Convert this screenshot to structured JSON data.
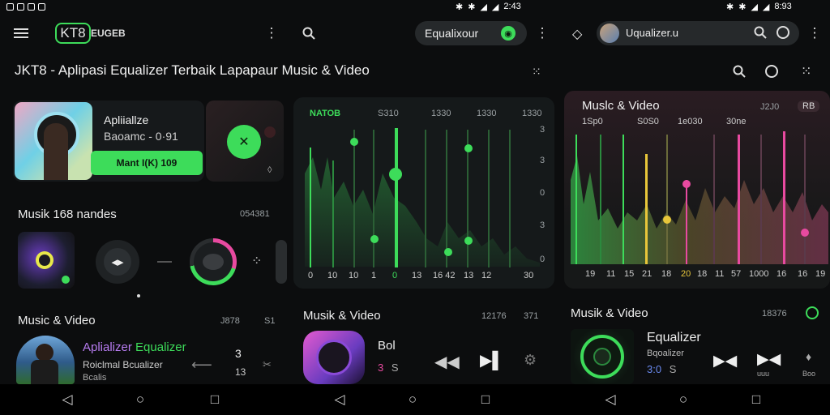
{
  "status_bar": {
    "left_time": "2:43",
    "right_time": "8:93"
  },
  "left_screen": {
    "logo_text": "KT8",
    "logo_suffix": "EUGEB",
    "headline": "JKT8 - Aplipasi Equalizer Terbaik Lapapaur Music & Video",
    "feature_card": {
      "title": "Apliiallze",
      "subtitle": "Baoamc - 0·91",
      "button_label": "Mant I(K) 109"
    },
    "section_title": "Musik 168 nandes",
    "section_meta": "054381",
    "music_section": {
      "title": "Music & Video",
      "meta1": "J878",
      "meta2": "S1"
    },
    "track": {
      "title_part1": "Aplializer",
      "title_part2": "Equalizer",
      "subtitle": "Roiclmal Bcualizer",
      "caption": "Bcalis",
      "number_top": "3",
      "number_bottom": "13"
    }
  },
  "middle_screen": {
    "search_pill_text": "Equalixour",
    "eq_header": {
      "label1": "NATOB",
      "label2": "S310",
      "label3": "1330",
      "label4": "1330",
      "label5": "1330"
    },
    "right_ticks": [
      "3",
      "3",
      "0",
      "3",
      "0"
    ],
    "bottom_ticks": [
      "0",
      "10",
      "10",
      "1",
      "0",
      "13",
      "16 42",
      "13",
      "12",
      "30"
    ],
    "section_title": "Musik & Video",
    "section_meta1": "12176",
    "section_meta2": "371",
    "track": {
      "title": "Bol",
      "subtitle": "3",
      "subtitle_extra": "S"
    }
  },
  "right_screen": {
    "search_pill_text": "Uqualizer.u",
    "eq_panel": {
      "title": "Muslc & Video",
      "meta1": "J2J0",
      "badge": "RB",
      "labels": [
        "1Sp0",
        "S0S0",
        "1e030",
        "30ne"
      ],
      "bottom_ticks": [
        "19",
        "11",
        "15",
        "21",
        "18",
        "20",
        "18",
        "11",
        "57",
        "1000",
        "16",
        "16",
        "19"
      ]
    },
    "section_title": "Musik & Video",
    "section_meta": "18376",
    "track": {
      "title": "Equalizer",
      "subtitle": "Bqoalizer",
      "number": "3:0",
      "extra": "S",
      "nav_label1": "uuu",
      "nav_label2": "Boo"
    }
  },
  "colors": {
    "accent_green": "#3ddc5a",
    "dark_bg": "#0c0d0e",
    "pink": "#e84aa0",
    "yellow": "#e8c63a"
  }
}
